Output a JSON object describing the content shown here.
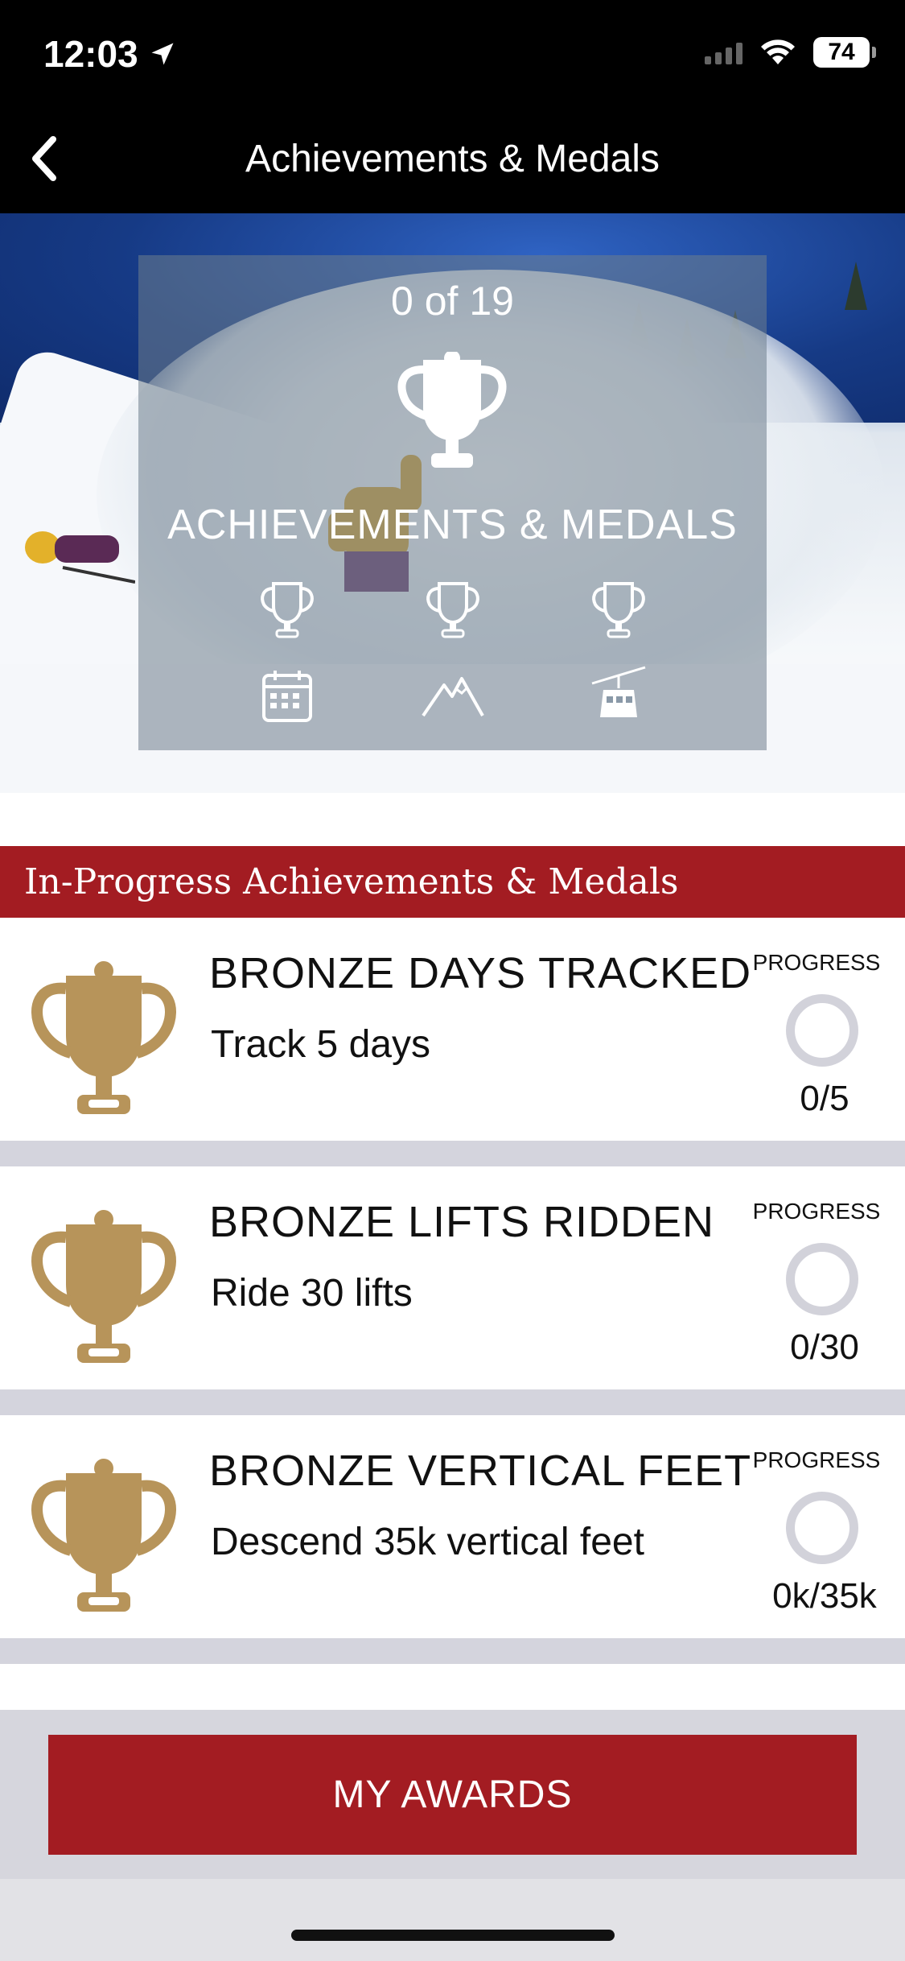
{
  "status_bar": {
    "time": "12:03",
    "battery": "74"
  },
  "nav": {
    "title": "Achievements & Medals"
  },
  "hero": {
    "count": "0 of 19",
    "heading": "ACHIEVEMENTS & MEDALS",
    "category_icons": [
      "trophy-icon",
      "trophy-icon",
      "trophy-icon",
      "calendar-icon",
      "mountain-icon",
      "gondola-icon"
    ]
  },
  "section": {
    "title": "In-Progress Achievements & Medals"
  },
  "achievements": [
    {
      "title": "BRONZE DAYS TRACKED",
      "description": "Track 5 days",
      "progress_label": "PROGRESS",
      "progress_value": "0/5",
      "progress_fraction": 0
    },
    {
      "title": "BRONZE LIFTS RIDDEN",
      "description": "Ride 30 lifts",
      "progress_label": "PROGRESS",
      "progress_value": "0/30",
      "progress_fraction": 0
    },
    {
      "title": "BRONZE VERTICAL FEET",
      "description": "Descend 35k vertical feet",
      "progress_label": "PROGRESS",
      "progress_value": "0k/35k",
      "progress_fraction": 0
    }
  ],
  "footer": {
    "button_label": "MY AWARDS"
  },
  "colors": {
    "brand_red": "#a31c22",
    "bronze": "#b7945a",
    "ring_gray": "#d2d2da"
  }
}
